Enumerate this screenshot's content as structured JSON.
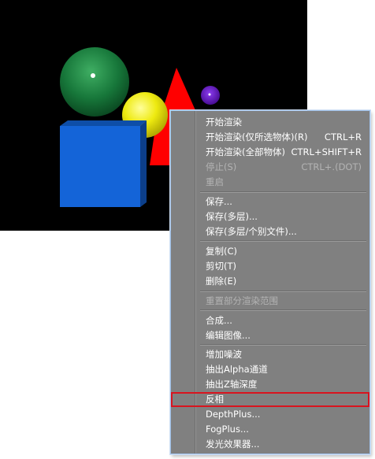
{
  "menu": {
    "items": [
      {
        "label": "开始渲染",
        "shortcut": "",
        "enabled": true,
        "highlighted": false
      },
      {
        "label": "开始渲染(仅所选物体)(R)",
        "shortcut": "CTRL+R",
        "enabled": true,
        "highlighted": false
      },
      {
        "label": "开始渲染(全部物体)",
        "shortcut": "CTRL+SHIFT+R",
        "enabled": true,
        "highlighted": false
      },
      {
        "label": "停止(S)",
        "shortcut": "CTRL+.(DOT)",
        "enabled": false,
        "highlighted": false
      },
      {
        "label": "重启",
        "shortcut": "",
        "enabled": false,
        "highlighted": false
      },
      {
        "label": "保存...",
        "shortcut": "",
        "enabled": true,
        "highlighted": false
      },
      {
        "label": "保存(多层)...",
        "shortcut": "",
        "enabled": true,
        "highlighted": false
      },
      {
        "label": "保存(多层/个别文件)...",
        "shortcut": "",
        "enabled": true,
        "highlighted": false
      },
      {
        "label": "复制(C)",
        "shortcut": "",
        "enabled": true,
        "highlighted": false
      },
      {
        "label": "剪切(T)",
        "shortcut": "",
        "enabled": true,
        "highlighted": false
      },
      {
        "label": "删除(E)",
        "shortcut": "",
        "enabled": true,
        "highlighted": false
      },
      {
        "label": "重置部分渲染范围",
        "shortcut": "",
        "enabled": false,
        "highlighted": false
      },
      {
        "label": "合成...",
        "shortcut": "",
        "enabled": true,
        "highlighted": false
      },
      {
        "label": "编辑图像...",
        "shortcut": "",
        "enabled": true,
        "highlighted": false
      },
      {
        "label": "增加噪波",
        "shortcut": "",
        "enabled": true,
        "highlighted": false
      },
      {
        "label": "抽出Alpha通道",
        "shortcut": "",
        "enabled": true,
        "highlighted": false
      },
      {
        "label": "抽出Z轴深度",
        "shortcut": "",
        "enabled": true,
        "highlighted": false
      },
      {
        "label": "反相",
        "shortcut": "",
        "enabled": true,
        "highlighted": true
      },
      {
        "label": "DepthPlus...",
        "shortcut": "",
        "enabled": true,
        "highlighted": false
      },
      {
        "label": "FogPlus...",
        "shortcut": "",
        "enabled": true,
        "highlighted": false
      },
      {
        "label": "发光效果器...",
        "shortcut": "",
        "enabled": true,
        "highlighted": false
      }
    ]
  },
  "colors": {
    "menu_bg": "#808080",
    "highlight_border": "#d9141e",
    "green_sphere": "#1c7a3c",
    "yellow_sphere": "#e8e000",
    "red_cone": "#ff0000",
    "purple_sphere": "#6a12c8",
    "blue_cube": "#1464d8"
  }
}
